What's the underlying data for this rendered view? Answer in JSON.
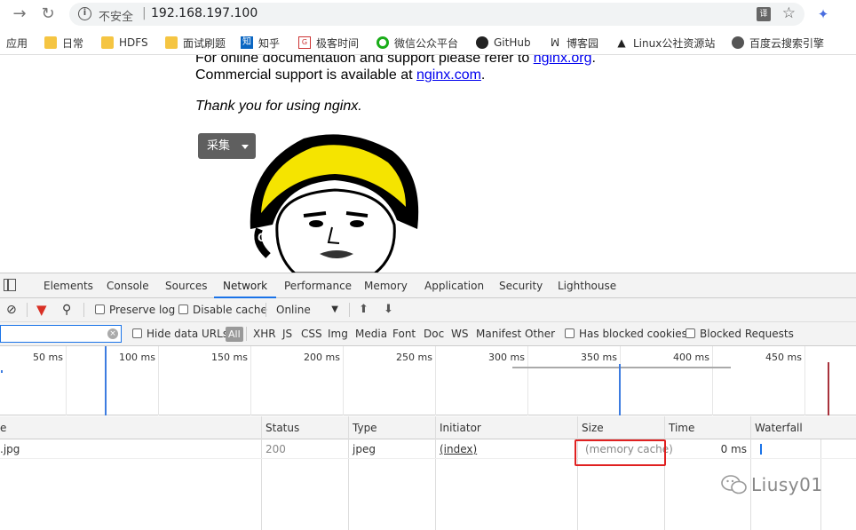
{
  "browser": {
    "security_label": "不安全",
    "separator": "|",
    "url": "192.168.197.100",
    "translate_icon": "translate-icon",
    "star_icon": "bookmark-star-icon"
  },
  "bookmarks": [
    {
      "label": "应用",
      "icon": "apps-icon"
    },
    {
      "label": "日常",
      "icon": "folder-icon"
    },
    {
      "label": "HDFS",
      "icon": "folder-icon"
    },
    {
      "label": "面试刷题",
      "icon": "folder-icon"
    },
    {
      "label": "知乎",
      "icon": "zhihu-icon"
    },
    {
      "label": "极客时间",
      "icon": "geektime-icon"
    },
    {
      "label": "微信公众平台",
      "icon": "wechat-mp-icon"
    },
    {
      "label": "GitHub",
      "icon": "github-icon"
    },
    {
      "label": "博客园",
      "icon": "cnblogs-icon"
    },
    {
      "label": "Linux公社资源站",
      "icon": "linux-icon"
    },
    {
      "label": "百度云搜索引擎",
      "icon": "baidu-cloud-icon"
    }
  ],
  "page": {
    "line1_prefix": "For online documentation and support please refer to ",
    "line1_link": "nginx.org",
    "line1_suffix": ".",
    "line2_prefix": "Commercial support is available at ",
    "line2_link": "nginx.com",
    "line2_suffix": ".",
    "thanks": "Thank you for using nginx.",
    "collect_button": "采集"
  },
  "devtools": {
    "tabs": [
      "Elements",
      "Console",
      "Sources",
      "Network",
      "Performance",
      "Memory",
      "Application",
      "Security",
      "Lighthouse"
    ],
    "active_tab": "Network",
    "toolbar": {
      "preserve_log": "Preserve log",
      "disable_cache": "Disable cache",
      "throttling": "Online"
    },
    "filters": {
      "hide_data_urls": "Hide data URLs",
      "types": [
        "All",
        "XHR",
        "JS",
        "CSS",
        "Img",
        "Media",
        "Font",
        "Doc",
        "WS",
        "Manifest",
        "Other"
      ],
      "has_blocked_cookies": "Has blocked cookies",
      "blocked_requests": "Blocked Requests"
    },
    "timeline_ticks": [
      "50 ms",
      "100 ms",
      "150 ms",
      "200 ms",
      "250 ms",
      "300 ms",
      "350 ms",
      "400 ms",
      "450 ms"
    ],
    "columns": [
      "e",
      "Status",
      "Type",
      "Initiator",
      "Size",
      "Time",
      "Waterfall"
    ],
    "rows": [
      {
        "name": ".jpg",
        "status": "200",
        "type": "jpeg",
        "initiator": "(index)",
        "size": "(memory cache)",
        "time": "0 ms"
      }
    ]
  },
  "watermark": "Liusy01"
}
